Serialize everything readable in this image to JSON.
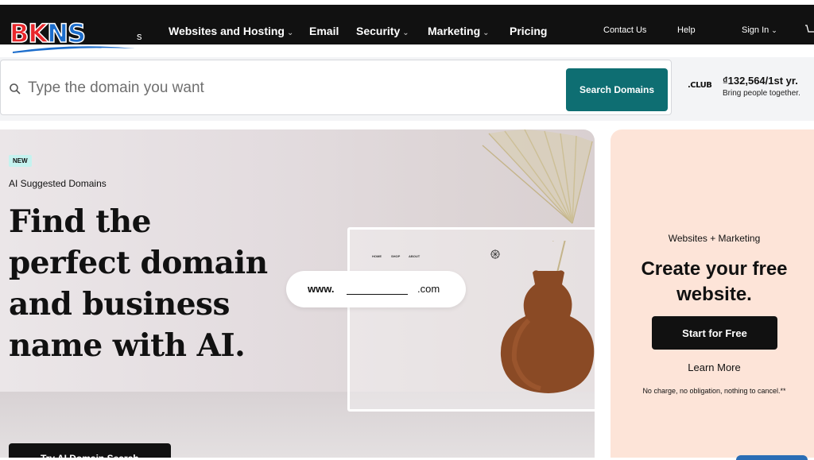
{
  "brand": {
    "logo_text_b": "B",
    "logo_text_k": "K",
    "logo_text_n": "N",
    "logo_text_s": "S",
    "logo_tail": "s",
    "accent": "#0e6e72"
  },
  "nav": {
    "items": [
      {
        "label": "Websites and Hosting"
      },
      {
        "label": "Email"
      },
      {
        "label": "Security"
      },
      {
        "label": "Marketing"
      },
      {
        "label": "Pricing"
      }
    ],
    "contact": "Contact Us",
    "help": "Help",
    "sign_in": "Sign In"
  },
  "search": {
    "placeholder": "Type the domain you want",
    "button": "Search Domains"
  },
  "promo": {
    "tld": ".CLUB",
    "price": "₫132,564/1st yr.",
    "tagline": "Bring people together."
  },
  "hero": {
    "badge": "NEW",
    "eyebrow": "AI Suggested Domains",
    "title": "Find the perfect domain and business name with AI.",
    "cta": "Try AI Domain Search",
    "mock_nav": [
      "HOME",
      "SHOP",
      "ABOUT"
    ],
    "url_prefix": "www.",
    "url_suffix": ".com"
  },
  "side": {
    "eyebrow": "Websites + Marketing",
    "title": "Create your free website.",
    "button": "Start for Free",
    "link": "Learn More",
    "fine_print": "No charge, no obligation, nothing to cancel.**"
  }
}
